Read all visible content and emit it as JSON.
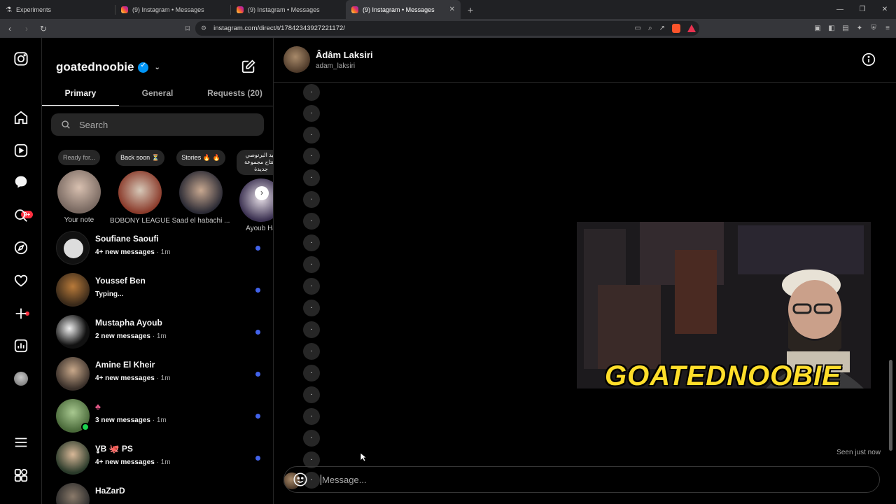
{
  "browser": {
    "tabs": [
      {
        "title": "Experiments",
        "active": false
      },
      {
        "title": "(9) Instagram • Messages",
        "active": false
      },
      {
        "title": "(9) Instagram • Messages",
        "active": false
      },
      {
        "title": "(9) Instagram • Messages",
        "active": true
      }
    ],
    "url": "instagram.com/direct/t/17842343927221172/",
    "new_tab": "+",
    "close_tab": "✕"
  },
  "rail": {
    "notifications_badge": "9+"
  },
  "inbox": {
    "username": "goatednoobie",
    "tabs": {
      "primary": "Primary",
      "general": "General",
      "requests": "Requests (20)"
    },
    "search_placeholder": "Search",
    "notes": [
      {
        "bubble": "Ready for...",
        "name": "Your note"
      },
      {
        "bubble": "Back soon ⏳",
        "name": "BOBONY LEAGUE"
      },
      {
        "bubble": "Stories 🔥 🔥",
        "name": "Saad el habachi ..."
      },
      {
        "bubble": "عيد البرنوصي افتتاح مجموعة جديدة",
        "name": "Ayoub Ha"
      }
    ],
    "conversations": [
      {
        "name": "Soufiane Saoufi",
        "preview": "4+ new messages",
        "ago": " · 1m"
      },
      {
        "name": "Youssef Ben",
        "preview": "Typing...",
        "ago": ""
      },
      {
        "name": "Mustapha Ayoub",
        "preview": "2 new messages",
        "ago": " · 1m"
      },
      {
        "name": "Amine El Kheir",
        "preview": "4+ new messages",
        "ago": " · 1m"
      },
      {
        "name": "♣",
        "preview": "3 new messages",
        "ago": " · 1m"
      },
      {
        "name": "ƔB 🐙 PS",
        "preview": "4+ new messages",
        "ago": " · 1m"
      },
      {
        "name": "HaZarD",
        "preview": "",
        "ago": ""
      }
    ]
  },
  "chat": {
    "contact_name": "Âdâm Laksiri",
    "contact_username": "adam_laksiri",
    "dot_message": ".",
    "video_caption": "GOATEDNOOBIE",
    "seen": "Seen just now",
    "composer_placeholder": "Message..."
  },
  "colors": {
    "accent": "#0095f6",
    "unread_dot": "#4263eb",
    "badge": "#ff3040"
  }
}
